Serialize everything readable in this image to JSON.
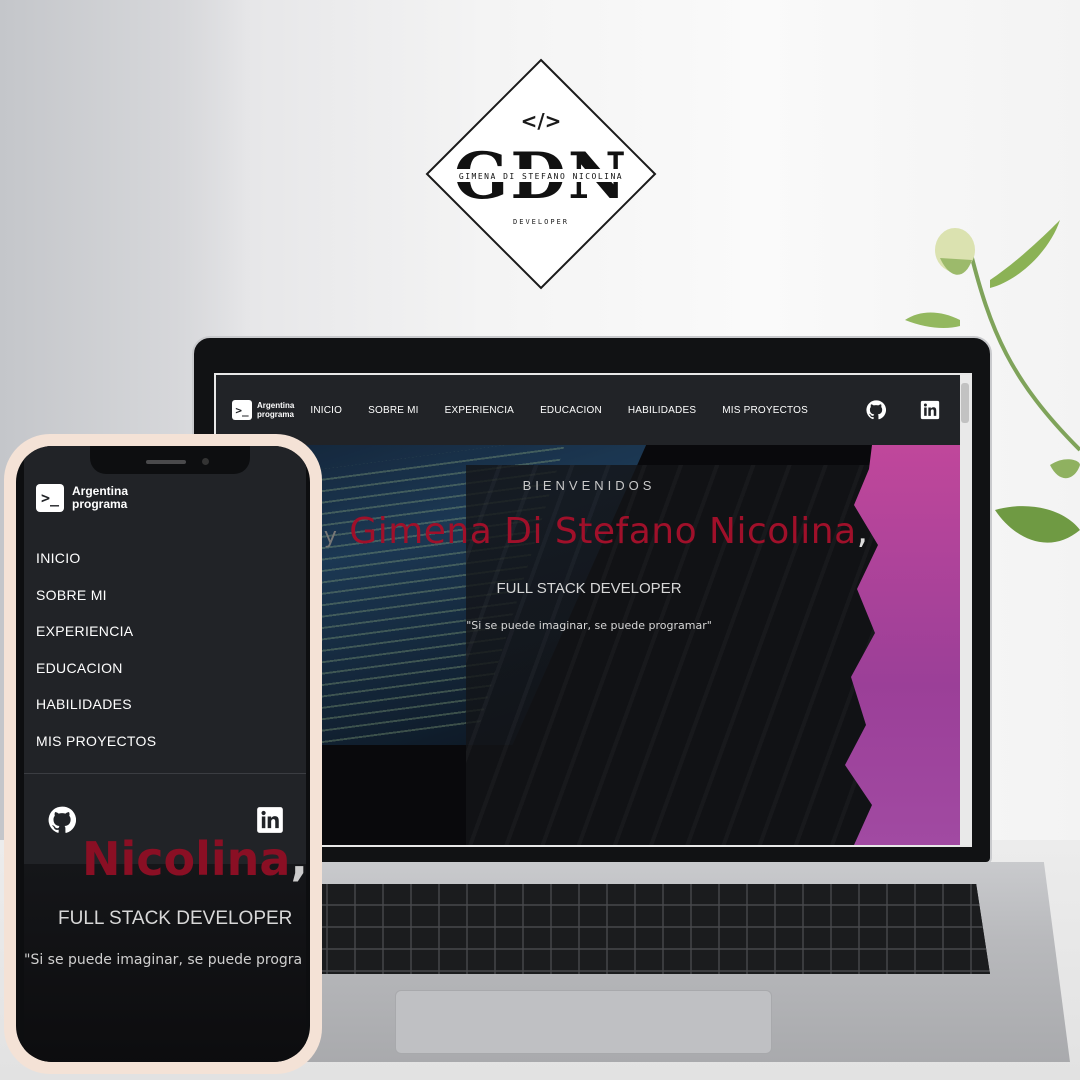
{
  "logo": {
    "initials": "GDN",
    "full_name": "GIMENA DI STEFANO NICOLINA",
    "subtitle": "DEVELOPER",
    "code_glyph": "</>"
  },
  "brand": {
    "line1": "Argentina",
    "line2": "programa",
    "icon": "terminal-prompt-icon",
    "glyph": ">_"
  },
  "nav": {
    "items": [
      "INICIO",
      "SOBRE MI",
      "EXPERIENCIA",
      "EDUCACION",
      "HABILIDADES",
      "MIS PROYECTOS"
    ],
    "icons": [
      "github-icon",
      "linkedin-icon"
    ]
  },
  "hero": {
    "welcome": "BIENVENIDOS",
    "by": "by",
    "name": "Gimena Di Stefano Nicolina",
    "comma": ",",
    "role": "FULL STACK DEVELOPER",
    "quote": "\"Si se puede imaginar, se puede programar\""
  },
  "phone_hero": {
    "name_fragment": "Nicolina",
    "comma": ",",
    "role": "FULL STACK DEVELOPER",
    "quote": "\"Si se puede imaginar, se puede progra"
  },
  "colors": {
    "nav_bg": "#212327",
    "accent_red": "#a0102a",
    "accent_purple": "#a9469f"
  }
}
